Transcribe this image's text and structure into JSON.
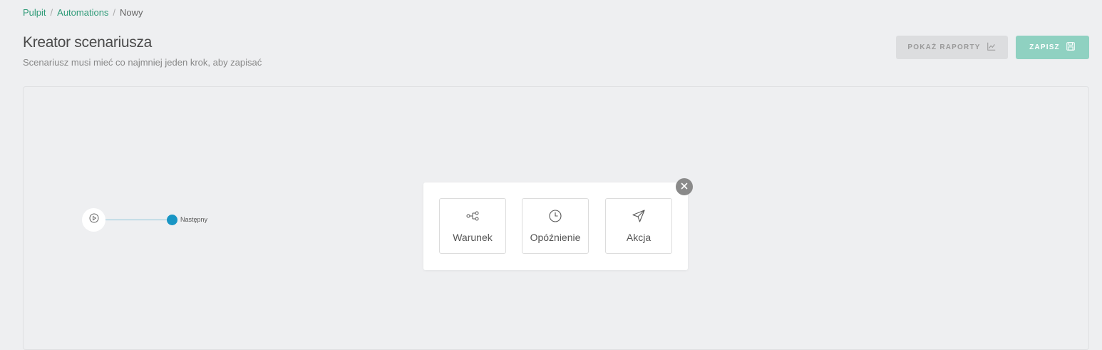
{
  "breadcrumb": {
    "items": [
      "Pulpit",
      "Automations",
      "Nowy"
    ],
    "separator": "/"
  },
  "header": {
    "title": "Kreator scenariusza",
    "subtitle": "Scenariusz musi mieć co najmniej jeden krok, aby zapisać"
  },
  "toolbar": {
    "reports_label": "POKAŻ RAPORTY",
    "reports_icon": "chart-line-icon",
    "save_label": "ZAPISZ",
    "save_icon": "floppy-disk-icon"
  },
  "flow": {
    "start_icon": "play-circle-icon",
    "next_label": "Następny"
  },
  "step_picker": {
    "close_icon": "close-icon",
    "options": [
      {
        "label": "Warunek",
        "icon": "branch-icon"
      },
      {
        "label": "Opóźnienie",
        "icon": "clock-icon"
      },
      {
        "label": "Akcja",
        "icon": "send-icon"
      }
    ]
  },
  "colors": {
    "link": "#2f9b78",
    "save_button": "#8fd1c1",
    "next_dot": "#1895c4",
    "background": "#eeeff1"
  }
}
